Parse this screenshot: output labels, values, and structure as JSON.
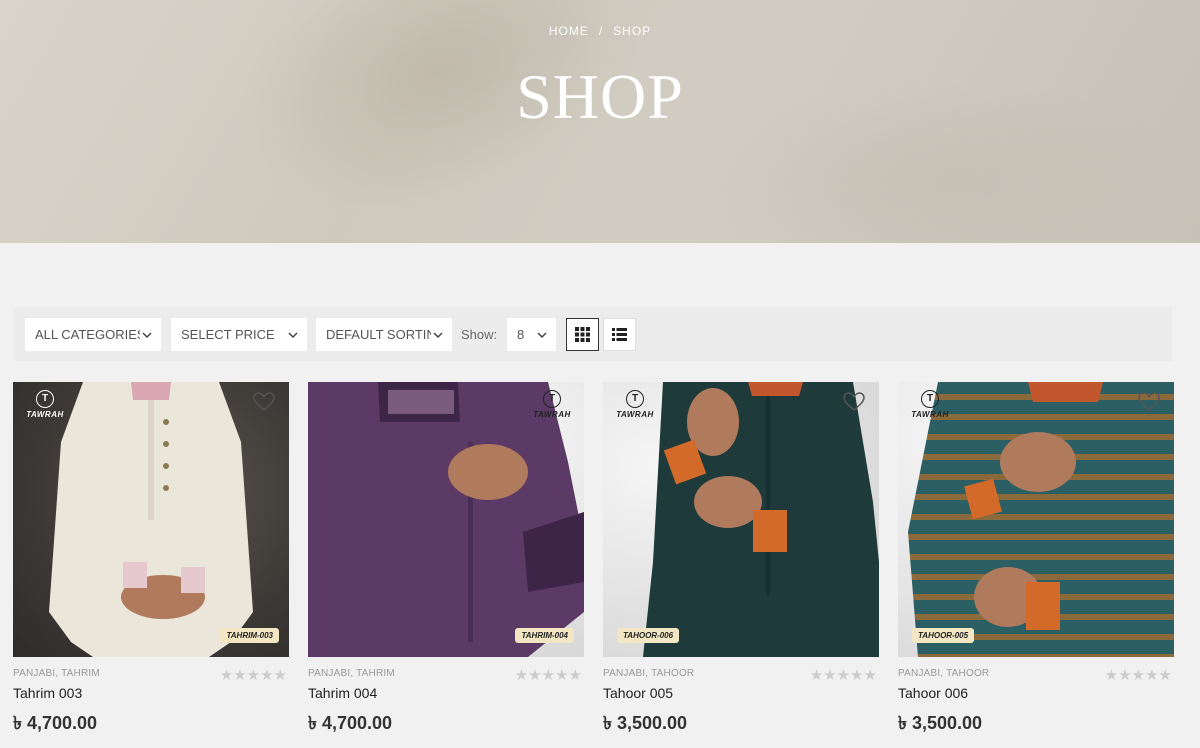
{
  "breadcrumb": {
    "home": "HOME",
    "separator": "/",
    "current": "SHOP"
  },
  "page_title": "SHOP",
  "toolbar": {
    "category_select": "ALL CATEGORIES",
    "price_select": "SELECT PRICE",
    "sort_select": "DEFAULT SORTING",
    "show_label": "Show:",
    "show_value": "8"
  },
  "products": [
    {
      "categories": "PANJABI, TAHRIM",
      "name": "Tahrim 003",
      "price": "৳ 4,700.00",
      "tag": "TAHRIM-003",
      "brand": "TAWRAH",
      "rating": 0,
      "color": "#ece7dc"
    },
    {
      "categories": "PANJABI, TAHRIM",
      "name": "Tahrim 004",
      "price": "৳ 4,700.00",
      "tag": "TAHRIM-004",
      "brand": "TAWRAH",
      "rating": 0,
      "color": "#5b3a66"
    },
    {
      "categories": "PANJABI, TAHOOR",
      "name": "Tahoor 005",
      "price": "৳ 3,500.00",
      "tag": "TAHOOR-006",
      "brand": "TAWRAH",
      "rating": 0,
      "color": "#1f3a3a"
    },
    {
      "categories": "PANJABI, TAHOOR",
      "name": "Tahoor 006",
      "price": "৳ 3,500.00",
      "tag": "TAHOOR-005",
      "brand": "TAWRAH",
      "rating": 0,
      "color": "#2c5f63"
    }
  ],
  "colors": {
    "hero_bg": "#d2cdc3",
    "page_bg": "#f1f1f1",
    "star_empty": "#cccccc"
  },
  "icons": {
    "chevron": "chevron-down-icon",
    "grid": "grid-view-icon",
    "list": "list-view-icon",
    "wishlist": "heart-icon",
    "star": "star-icon"
  }
}
